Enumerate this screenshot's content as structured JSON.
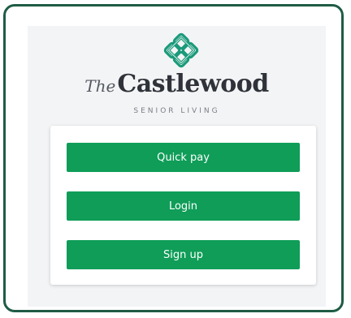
{
  "brand": {
    "the": "The",
    "name": "Castlewood",
    "subtitle": "SENIOR LIVING",
    "logo_icon": "celtic-knot-icon",
    "logo_color": "#1a9a7a"
  },
  "actions": {
    "quick_pay": "Quick pay",
    "login": "Login",
    "sign_up": "Sign up"
  },
  "colors": {
    "frame_border": "#1f5c45",
    "button": "#0f9d58",
    "panel_bg": "#f3f4f6"
  }
}
